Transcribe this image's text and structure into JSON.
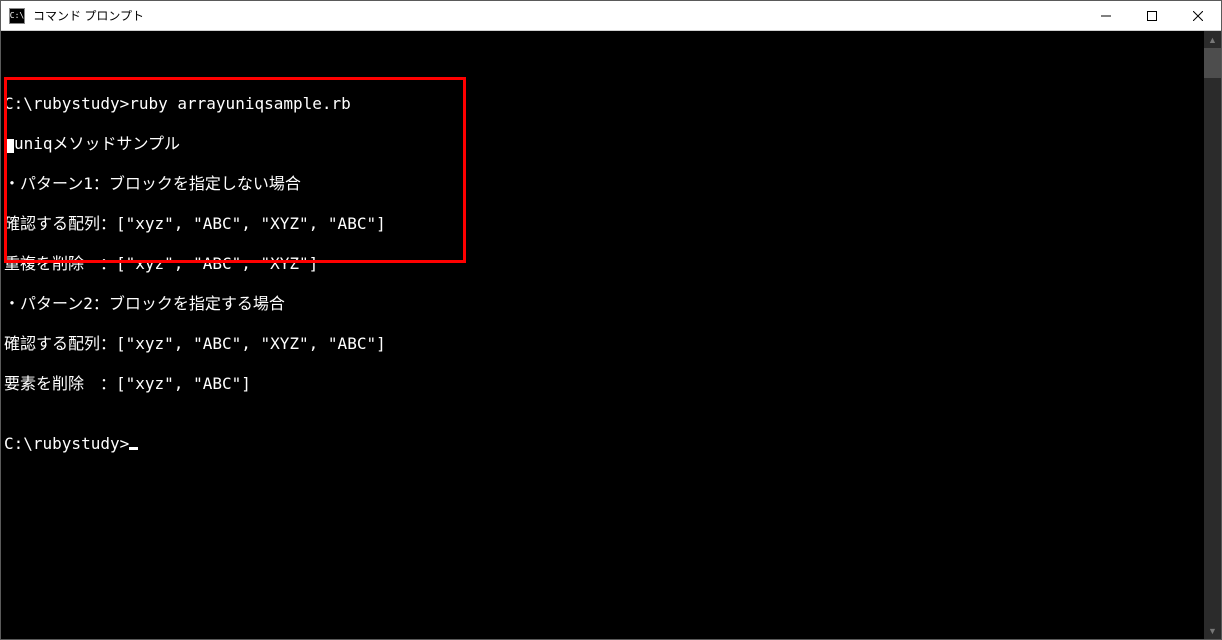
{
  "window": {
    "title": "コマンド プロンプト",
    "app_icon_text": "C:\\"
  },
  "console": {
    "blank": "",
    "blank2": "",
    "cmd_line": "C:\\rubystudy>ruby arrayuniqsample.rb",
    "out1_suffix": "uniqメソッドサンプル",
    "out2": "・パターン1：ブロックを指定しない場合",
    "out3": "確認する配列：[\"xyz\", \"ABC\", \"XYZ\", \"ABC\"]",
    "out4": "重複を削除　：[\"xyz\", \"ABC\", \"XYZ\"]",
    "out5": "・パターン2：ブロックを指定する場合",
    "out6": "確認する配列：[\"xyz\", \"ABC\", \"XYZ\", \"ABC\"]",
    "out7": "要素を削除　：[\"xyz\", \"ABC\"]",
    "prompt": "C:\\rubystudy>"
  }
}
